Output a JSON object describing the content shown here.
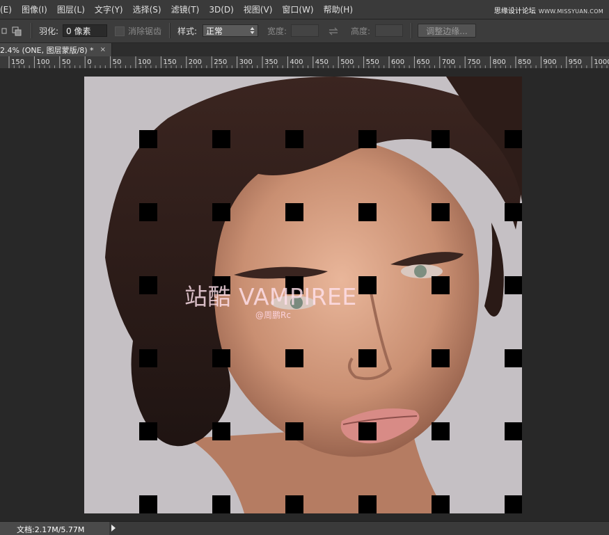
{
  "menu": {
    "items": [
      "(E)",
      "图像(I)",
      "图层(L)",
      "文字(Y)",
      "选择(S)",
      "滤镜(T)",
      "3D(D)",
      "视图(V)",
      "窗口(W)",
      "帮助(H)"
    ]
  },
  "watermark": {
    "text": "思缘设计论坛",
    "site": "WWW.MISSYUAN.COM"
  },
  "options": {
    "feather_label": "羽化:",
    "feather_value": "0 像素",
    "antialias_label": "消除锯齿",
    "style_label": "样式:",
    "style_value": "正常",
    "width_label": "宽度:",
    "height_label": "高度:",
    "refine_button": "调整边缘..."
  },
  "tab": {
    "title": "2.4% (ONE, 图层蒙版/8) *",
    "close": "×"
  },
  "ruler": {
    "labels": [
      "150",
      "100",
      "50",
      "0",
      "50",
      "100",
      "150",
      "200",
      "250",
      "300",
      "350",
      "400",
      "450",
      "500",
      "550",
      "600",
      "650",
      "700",
      "750",
      "800",
      "850",
      "900",
      "950",
      "1000"
    ]
  },
  "canvas": {
    "overlay_title": "站酷 VAMPIREE",
    "overlay_author": "@周鹏Rc",
    "grid": {
      "rows": 6,
      "cols": 6
    }
  },
  "status": {
    "text": "文档:2.17M/5.77M"
  },
  "colors": {
    "menubar": "#3a3a3a",
    "workspace": "#282828",
    "canvas_bg": "#c4bfc3",
    "square": "#000000"
  }
}
